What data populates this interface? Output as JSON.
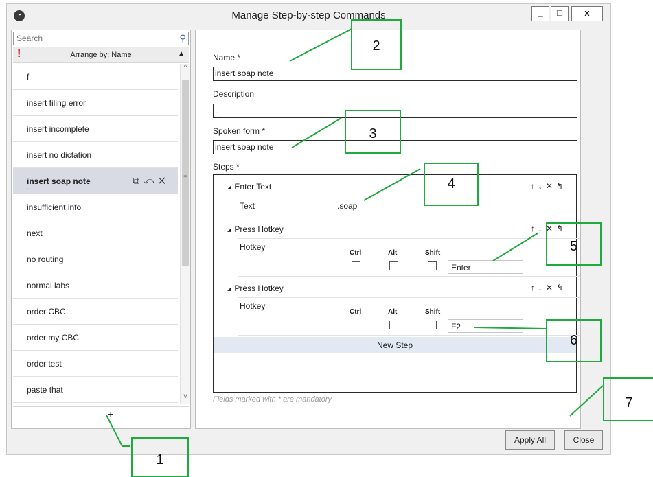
{
  "window": {
    "title": "Manage Step-by-step Commands",
    "minimize": "_",
    "maximize": "□",
    "close": "x"
  },
  "left_panel": {
    "search_placeholder": "Search",
    "arrange_label": "Arrange by: Name",
    "items": [
      "f",
      "insert filing error",
      "insert incomplete",
      "insert no dictation",
      "insert soap note",
      "insufficient info",
      "next",
      "no routing",
      "normal labs",
      "order CBC",
      "order my CBC",
      "order test",
      "paste that"
    ],
    "selected_item": "insert soap note",
    "selected_sub": ".",
    "add_label": "+"
  },
  "form": {
    "name_label": "Name *",
    "name_value": "insert soap note",
    "description_label": "Description",
    "description_value": ".",
    "spoken_label": "Spoken form *",
    "spoken_value": "insert soap note",
    "steps_label": "Steps *",
    "steps": [
      {
        "type": "Enter Text",
        "field_label": "Text",
        "value": ".soap"
      },
      {
        "type": "Press Hotkey",
        "field_label": "Hotkey",
        "ctrl": "Ctrl",
        "alt": "Alt",
        "shift": "Shift",
        "key": "Enter"
      },
      {
        "type": "Press Hotkey",
        "field_label": "Hotkey",
        "ctrl": "Ctrl",
        "alt": "Alt",
        "shift": "Shift",
        "key": "F2"
      }
    ],
    "new_step_label": "New Step",
    "mandatory_note": "Fields marked with * are mandatory"
  },
  "buttons": {
    "apply_all": "Apply All",
    "close": "Close"
  },
  "callouts": [
    "1",
    "2",
    "3",
    "4",
    "5",
    "6",
    "7"
  ],
  "colors": {
    "callout": "#1eaa3c",
    "selection": "#d8dbe4",
    "new_step": "#e2e9f3"
  }
}
